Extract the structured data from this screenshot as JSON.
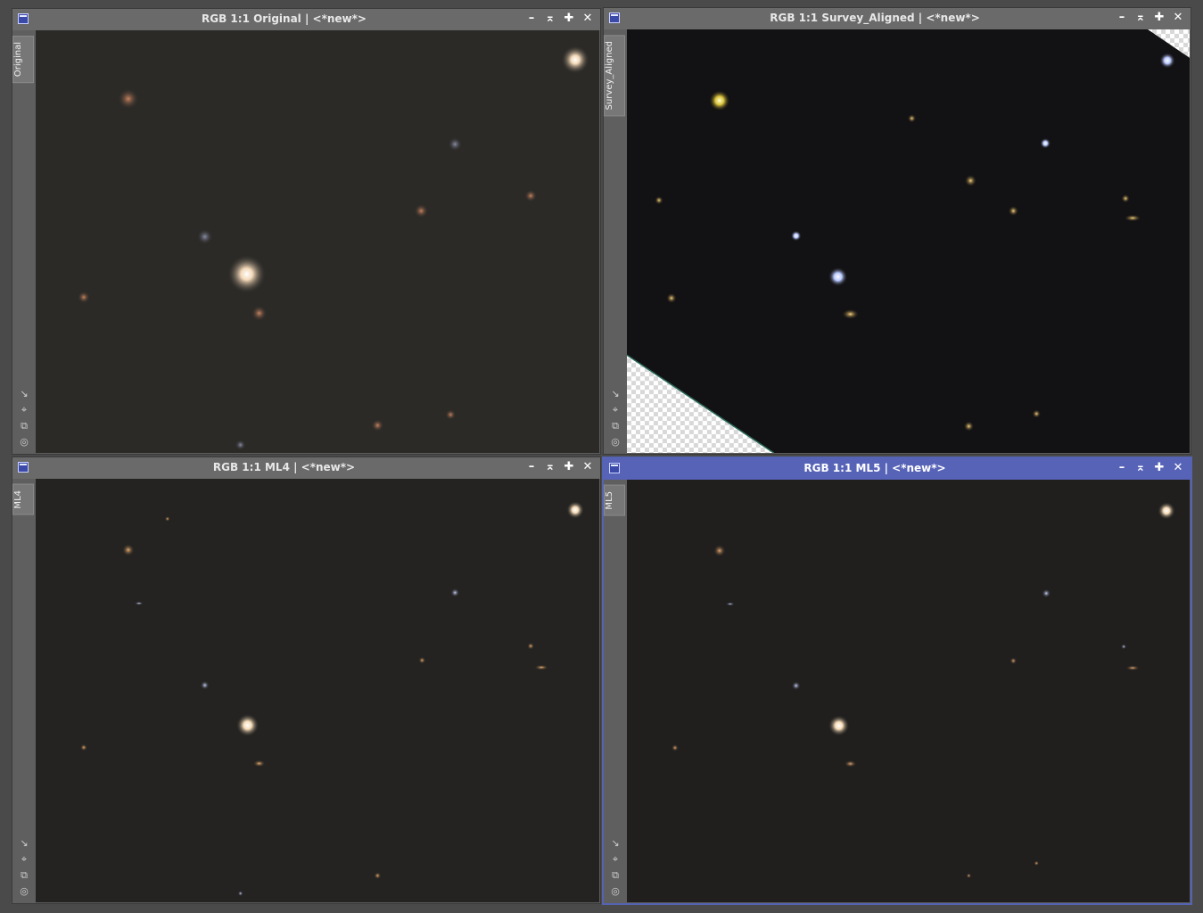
{
  "windows": [
    {
      "title": "RGB 1:1 Original | <*new*>",
      "tab": "Original"
    },
    {
      "title": "RGB 1:1 Survey_Aligned | <*new*>",
      "tab": "Survey_Aligned"
    },
    {
      "title": "RGB 1:1 ML4 | <*new*>",
      "tab": "ML4"
    },
    {
      "title": "RGB 1:1 ML5 | <*new*>",
      "tab": "ML5"
    }
  ],
  "controls": {
    "minimize": "–",
    "shade": "⌅",
    "maximize": "✚",
    "close": "✕"
  },
  "side_icons": [
    "↘",
    "⌖",
    "⧉",
    "◎"
  ],
  "colors": {
    "active_title": "#5763b7",
    "inactive_title": "#6a6a6a",
    "workspace": "#4a4a4a"
  }
}
